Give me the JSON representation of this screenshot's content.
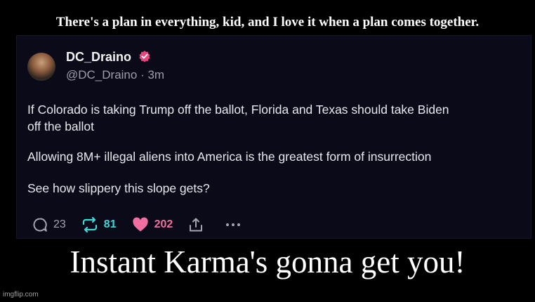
{
  "meme": {
    "top_caption": "There's a plan in everything, kid, and I love it when a plan comes together.",
    "bottom_caption": "Instant Karma's gonna get you!",
    "watermark": "imgflip.com"
  },
  "post": {
    "author_name": "DC_Draino",
    "handle_line": "@DC_Draino · 3m",
    "text_lines": [
      "If Colorado is taking Trump off the ballot, Florida and Texas should take Biden",
      "off the ballot",
      "Allowing 8M+ illegal aliens into America is the greatest form of insurrection",
      "See how slippery this slope gets?"
    ],
    "replies": "23",
    "reposts": "81",
    "likes": "202",
    "icons": {
      "verified": "verified-badge-icon",
      "reply": "reply-icon",
      "repost": "repost-icon",
      "like": "heart-icon",
      "share": "share-icon",
      "more": "more-icon"
    }
  },
  "colors": {
    "background": "#000000",
    "card": "#0a0a18",
    "repost": "#3fd7d7",
    "like": "#f06fa0",
    "verified": "#e8467c"
  }
}
